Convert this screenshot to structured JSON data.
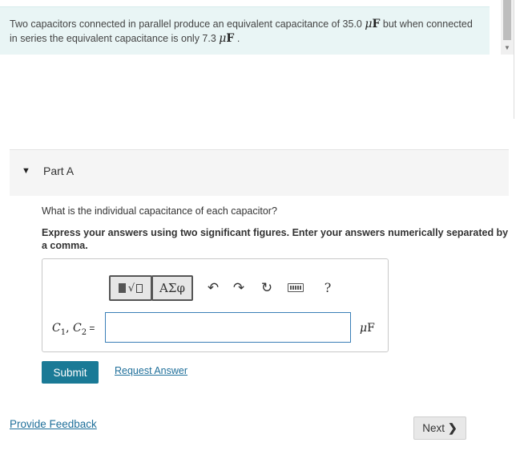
{
  "problem": {
    "text_before": "Two capacitors connected in parallel produce an equivalent capacitance of 35.0 ",
    "unit1_mu": "μ",
    "unit1_F": "F",
    "text_middle": " but when connected in series the equivalent capacitance is only 7.3 ",
    "unit2_mu": "μ",
    "unit2_F": "F",
    "text_after": " ."
  },
  "part": {
    "caret": "▼",
    "title": "Part A"
  },
  "question": "What is the individual capacitance of each capacitor?",
  "instructions": "Express your answers using two significant figures. Enter your answers numerically separated by a comma.",
  "toolbar": {
    "templates_icon": "templates-icon",
    "greek_label": "ΑΣφ",
    "undo_icon": "↶",
    "redo_icon": "↷",
    "reset_icon": "↻",
    "keyboard_icon": "keyboard-icon",
    "help_label": "?"
  },
  "answer": {
    "var1": "C",
    "sub1": "1",
    "sep": ", ",
    "var2": "C",
    "sub2": "2",
    "eq": " =",
    "value": "",
    "unit_mu": "μ",
    "unit_F": "F"
  },
  "buttons": {
    "submit": "Submit",
    "request_answer": "Request Answer",
    "provide_feedback": "Provide Feedback",
    "next": "Next",
    "next_chevron": "❯"
  },
  "colors": {
    "problem_bg": "#e9f5f5",
    "submit_bg": "#1a7a96",
    "link": "#1f6f9a",
    "input_border": "#3a7fb7"
  }
}
